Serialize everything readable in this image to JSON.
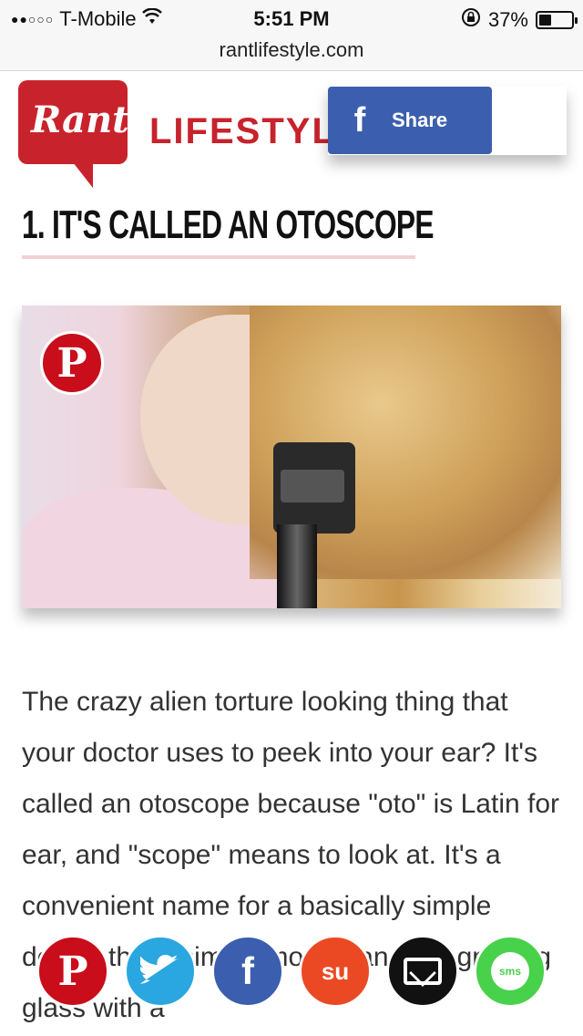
{
  "status_bar": {
    "signal": "●●○○○",
    "carrier": "T-Mobile",
    "wifi_icon": "wifi-icon",
    "time": "5:51 PM",
    "rotation_lock_icon": "rotation-lock-icon",
    "battery_percent": "37%",
    "battery_level": 0.37
  },
  "browser": {
    "url": "rantlifestyle.com"
  },
  "site": {
    "logo_text": "Rant",
    "brand": "LIFESTYLE",
    "share_button": {
      "icon": "facebook-icon",
      "icon_glyph": "f",
      "label": "Share"
    }
  },
  "article": {
    "heading": "1. IT'S CALLED AN OTOSCOPE",
    "image_pin_glyph": "P",
    "body": "The crazy alien torture looking thing that your doctor uses to peek into your ear? It's called an otoscope because \"oto\" is Latin for ear, and \"scope\" means to look at. It's a convenient name for a basically simple device that's simply more than a magnifying glass with a"
  },
  "social_bar": {
    "pinterest": "P",
    "twitter": "🐦",
    "facebook": "f",
    "stumbleupon": "su",
    "email": "email-icon",
    "sms": "sms"
  },
  "colors": {
    "brand_red": "#c8232c",
    "facebook_blue": "#3b5fae",
    "twitter_blue": "#2aa6e0",
    "pinterest_red": "#c90d1a",
    "stumbleupon_orange": "#eb4924",
    "sms_green": "#48d14b",
    "heading_rule_pink": "#f3cfd4"
  }
}
